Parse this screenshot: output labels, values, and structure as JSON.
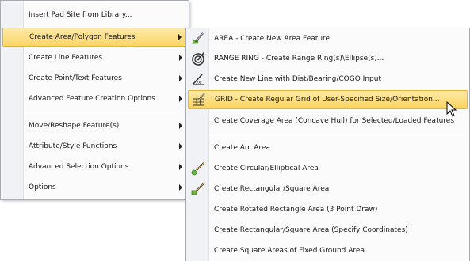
{
  "main_menu": {
    "items": [
      {
        "label": "Insert Pad Site from Library..."
      },
      {
        "label": "Create Area/Polygon Features"
      },
      {
        "label": "Create Line Features"
      },
      {
        "label": "Create Point/Text Features"
      },
      {
        "label": "Advanced Feature Creation Options"
      },
      {
        "label": "Move/Reshape Feature(s)"
      },
      {
        "label": "Attribute/Style Functions"
      },
      {
        "label": "Advanced Selection Options"
      },
      {
        "label": "Options"
      }
    ],
    "open_item": "Create Area/Polygon Features"
  },
  "sub_menu": {
    "items": [
      {
        "label": "AREA - Create New Area Feature",
        "icon": "area-pencil-icon"
      },
      {
        "label": "RANGE RING - Create Range Ring(s)\\Ellipse(s)...",
        "icon": "range-ring-target-icon"
      },
      {
        "label": "Create New Line with Dist/Bearing/COGO Input",
        "icon": "cogo-line-icon"
      },
      {
        "label": "GRID - Create Regular Grid of User-Specified Size/Orientation...",
        "icon": "grid-pencil-icon"
      },
      {
        "label": "Create Coverage Area (Concave Hull) for Selected/Loaded Features"
      },
      {
        "label": "Create Arc Area"
      },
      {
        "label": "Create Circular/Elliptical Area",
        "icon": "circle-pencil-icon"
      },
      {
        "label": "Create Rectangular/Square Area",
        "icon": "rectangle-pencil-icon"
      },
      {
        "label": "Create Rotated Rectangle Area (3 Point Draw)"
      },
      {
        "label": "Create Rectangular/Square Area (Specify Coordinates)"
      },
      {
        "label": "Create Square Areas of Fixed Ground Area"
      }
    ],
    "hovered_item": "GRID - Create Regular Grid of User-Specified Size/Orientation..."
  },
  "colors": {
    "highlight": "#fbd567",
    "highlight_border": "#e4b535",
    "menu_bg": "#fbfbfb",
    "gutter": "#f0f2f5"
  }
}
